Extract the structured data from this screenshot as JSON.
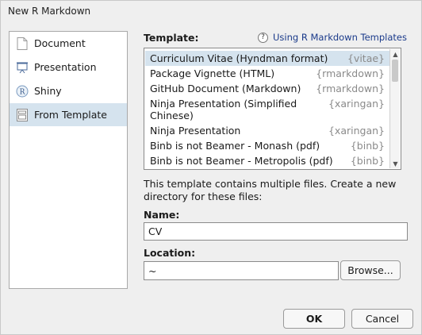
{
  "window": {
    "title": "New R Markdown"
  },
  "sidebar": {
    "items": [
      {
        "label": "Document",
        "icon": "document-icon",
        "selected": false
      },
      {
        "label": "Presentation",
        "icon": "presentation-icon",
        "selected": false
      },
      {
        "label": "Shiny",
        "icon": "shiny-icon",
        "selected": false
      },
      {
        "label": "From Template",
        "icon": "template-icon",
        "selected": true
      }
    ]
  },
  "template": {
    "label": "Template:",
    "help_icon_glyph": "?",
    "help_link": "Using R Markdown Templates",
    "rows": [
      {
        "name": "Curriculum Vitae (Hyndman format)",
        "package": "{vitae}",
        "selected": true
      },
      {
        "name": "Package Vignette (HTML)",
        "package": "{rmarkdown}",
        "selected": false
      },
      {
        "name": "GitHub Document (Markdown)",
        "package": "{rmarkdown}",
        "selected": false
      },
      {
        "name": "Ninja Presentation (Simplified\nChinese)",
        "package": "{xaringan}",
        "selected": false
      },
      {
        "name": "Ninja Presentation",
        "package": "{xaringan}",
        "selected": false
      },
      {
        "name": "Binb is not Beamer - Monash (pdf)",
        "package": "{binb}",
        "selected": false
      },
      {
        "name": "Binb is not Beamer - Metropolis (pdf)",
        "package": "{binb}",
        "selected": false
      }
    ]
  },
  "description": "This template contains multiple files. Create a new directory for these files:",
  "name_field": {
    "label": "Name:",
    "value": "CV"
  },
  "location_field": {
    "label": "Location:",
    "value": "~"
  },
  "buttons": {
    "browse": "Browse...",
    "ok": "OK",
    "cancel": "Cancel"
  },
  "colors": {
    "selection": "#d5e3ee",
    "link": "#1a3a8a",
    "package_text": "#8a8a8a"
  }
}
